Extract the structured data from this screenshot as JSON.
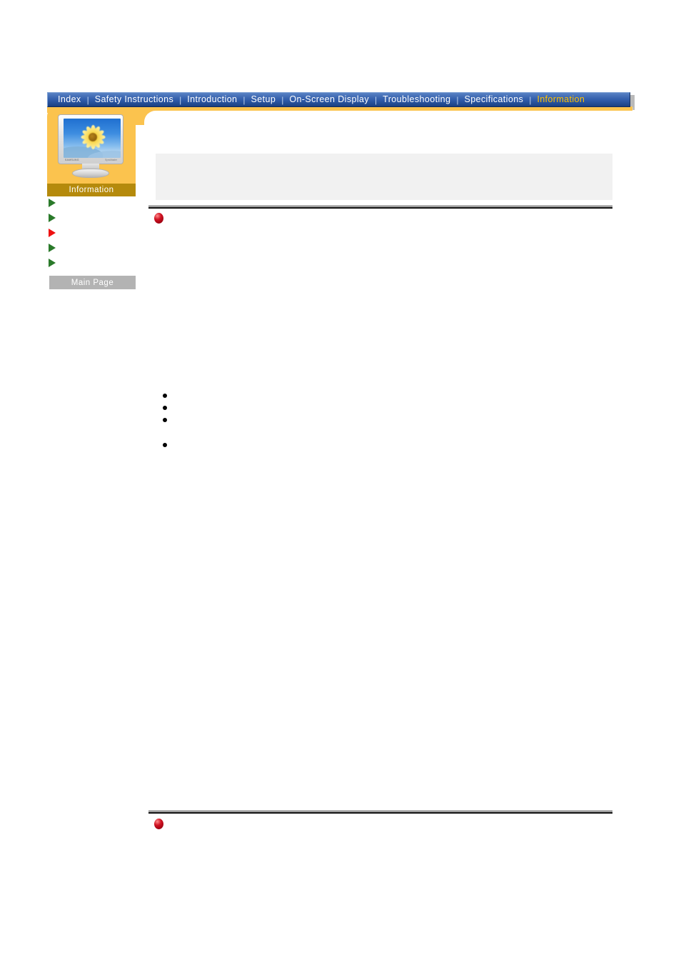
{
  "page": {
    "title": "Information",
    "background_color": "#ffffff"
  },
  "navbar": {
    "background_color": "#2e5aa8",
    "text_color": "#ffffff",
    "active_color": "#ffc000",
    "separator": "|",
    "items": [
      {
        "label": "Index",
        "active": false
      },
      {
        "label": "Safety Instructions",
        "active": false
      },
      {
        "label": "Introduction",
        "active": false
      },
      {
        "label": "Setup",
        "active": false
      },
      {
        "label": "On-Screen Display",
        "active": false
      },
      {
        "label": "Troubleshooting",
        "active": false
      },
      {
        "label": "Specifications",
        "active": false
      },
      {
        "label": "Information",
        "active": true
      }
    ]
  },
  "sidebar": {
    "frame_color": "#fbc34e",
    "label_bar": {
      "text": "Information",
      "background_color": "#b58a0c",
      "text_color": "#ffffff"
    },
    "thumbnail": {
      "device": "samsung-lcd-monitor",
      "screen_image": "sunflower-on-blue-sky",
      "bezel_brand": "SAMSUNG",
      "bezel_model": "SyncMaster"
    },
    "items": [
      {
        "label": "",
        "marker": "green-triangle",
        "marker_color": "#2a7a2a"
      },
      {
        "label": "",
        "marker": "green-triangle",
        "marker_color": "#2a7a2a"
      },
      {
        "label": "",
        "marker": "red-triangle",
        "marker_color": "#ee1111"
      },
      {
        "label": "",
        "marker": "green-triangle",
        "marker_color": "#2a7a2a"
      },
      {
        "label": "",
        "marker": "green-triangle",
        "marker_color": "#2a7a2a"
      }
    ],
    "main_page_button": {
      "label": "Main Page",
      "background_color": "#b3b3b3",
      "text_color": "#ffffff"
    }
  },
  "content": {
    "notice_box": {
      "text": "",
      "background_color": "#f1f1f1"
    },
    "sections": [
      {
        "marker": "red-sphere",
        "title": ""
      },
      {
        "marker": "red-sphere",
        "title": ""
      }
    ],
    "bullets": [
      {
        "text": "",
        "marker": "disc"
      },
      {
        "text": "",
        "marker": "disc"
      },
      {
        "text": "",
        "marker": "disc"
      },
      {
        "text": "",
        "marker": "disc",
        "spaced": true
      }
    ]
  }
}
